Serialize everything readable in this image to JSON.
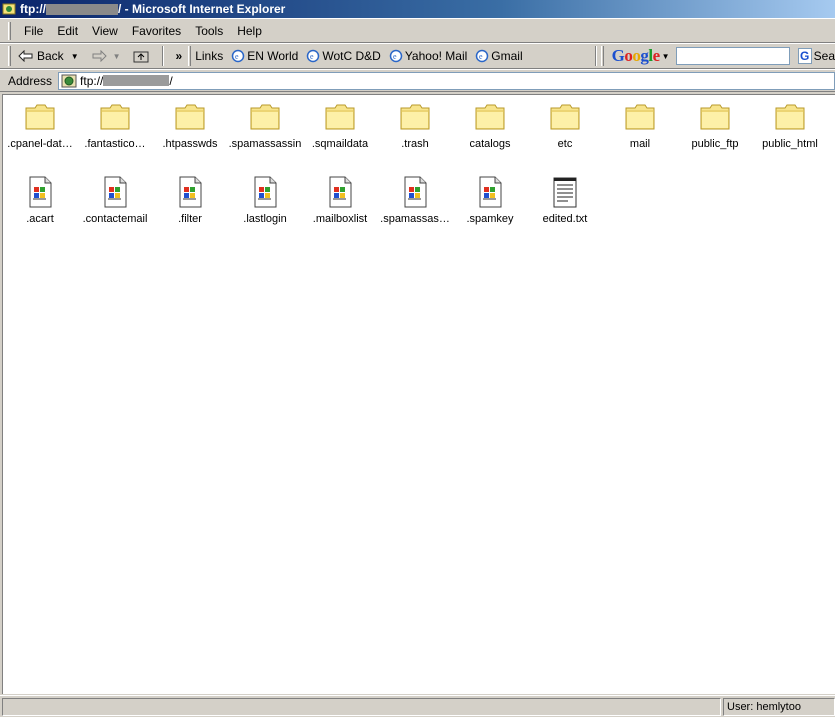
{
  "window": {
    "title_prefix": "ftp://",
    "title_suffix": "/ - Microsoft Internet Explorer"
  },
  "menu": {
    "items": [
      "File",
      "Edit",
      "View",
      "Favorites",
      "Tools",
      "Help"
    ]
  },
  "toolbar": {
    "back_label": "Back",
    "links_label": "Links",
    "chevron": "»",
    "links": [
      "EN World",
      "WotC D&D",
      "Yahoo! Mail",
      "Gmail"
    ],
    "google_search_label": "Sea"
  },
  "address": {
    "label": "Address",
    "value_prefix": "ftp://",
    "value_suffix": "/"
  },
  "files": [
    {
      "name": ".cpanel-dat…",
      "type": "folder"
    },
    {
      "name": ".fantastico…",
      "type": "folder"
    },
    {
      "name": ".htpasswds",
      "type": "folder"
    },
    {
      "name": ".spamassassin",
      "type": "folder"
    },
    {
      "name": ".sqmaildata",
      "type": "folder"
    },
    {
      "name": ".trash",
      "type": "folder"
    },
    {
      "name": "catalogs",
      "type": "folder"
    },
    {
      "name": "etc",
      "type": "folder"
    },
    {
      "name": "mail",
      "type": "folder"
    },
    {
      "name": "public_ftp",
      "type": "folder"
    },
    {
      "name": "public_html",
      "type": "folder"
    },
    {
      "name": ".acart",
      "type": "file"
    },
    {
      "name": ".contactemail",
      "type": "file"
    },
    {
      "name": ".filter",
      "type": "file"
    },
    {
      "name": ".lastlogin",
      "type": "file"
    },
    {
      "name": ".mailboxlist",
      "type": "file"
    },
    {
      "name": ".spamassas…",
      "type": "file"
    },
    {
      "name": ".spamkey",
      "type": "file"
    },
    {
      "name": "edited.txt",
      "type": "text"
    }
  ],
  "status": {
    "user": "User: hemlytoo"
  }
}
